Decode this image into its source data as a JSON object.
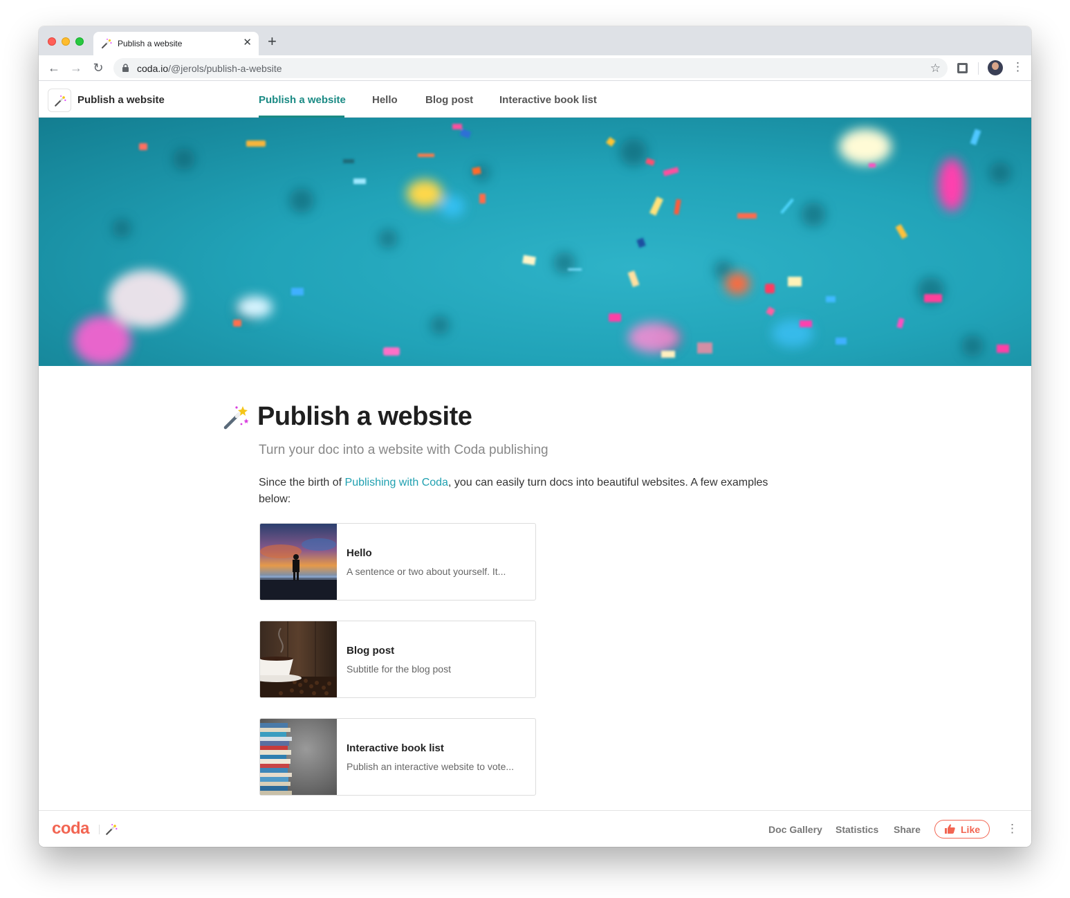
{
  "browser": {
    "tab_title": "Publish a website",
    "close_glyph": "✕",
    "new_tab_glyph": "+",
    "url_host": "coda.io",
    "url_path": "/@jerols/publish-a-website",
    "back_glyph": "←",
    "forward_glyph": "→",
    "reload_glyph": "↻",
    "star_glyph": "☆",
    "menu_glyph": "⋮"
  },
  "doc": {
    "name": "Publish a website",
    "nav": [
      {
        "label": "Publish a website",
        "active": true
      },
      {
        "label": "Hello",
        "active": false
      },
      {
        "label": "Blog post",
        "active": false
      },
      {
        "label": "Interactive book list",
        "active": false
      }
    ]
  },
  "page": {
    "title": "Publish a website",
    "subtitle": "Turn your doc into a website with Coda publishing",
    "body_prefix": "Since the birth of ",
    "body_link": "Publishing with Coda",
    "body_suffix": ", you can easily turn docs into beautiful websites. A few examples below:"
  },
  "cards": [
    {
      "title": "Hello",
      "desc": "A sentence or two about yourself. It..."
    },
    {
      "title": "Blog post",
      "desc": "Subtitle for the blog post"
    },
    {
      "title": "Interactive book list",
      "desc": "Publish an interactive website to vote..."
    }
  ],
  "footer": {
    "logo": "coda",
    "links": [
      "Doc Gallery",
      "Statistics",
      "Share"
    ],
    "like_label": "Like",
    "more_glyph": "⋮"
  },
  "colors": {
    "accent": "#1a8a84",
    "link": "#1fa0b0",
    "brand": "#f26552",
    "hero": "#21a3b8"
  }
}
